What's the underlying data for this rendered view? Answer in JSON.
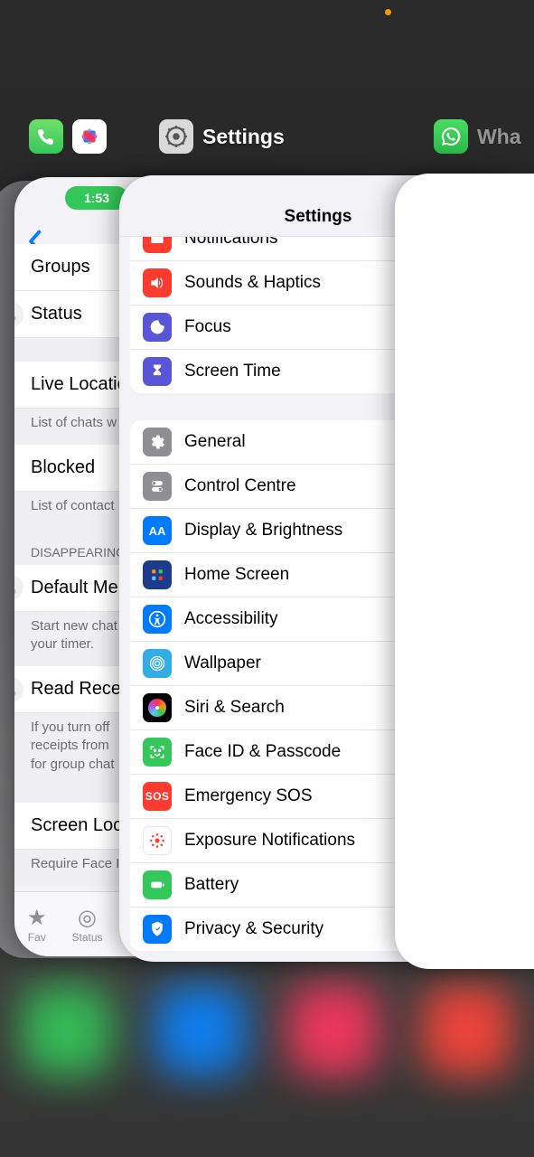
{
  "switcher": {
    "settings_label": "Settings",
    "whatsapp_label": "Wha"
  },
  "whatsapp_card": {
    "status_time": "1:53",
    "rows": {
      "groups": "Groups",
      "status": "Status",
      "live_location": "Live Locatio",
      "live_location_sub": "List of chats w",
      "blocked": "Blocked",
      "blocked_sub": "List of contact",
      "disappearing_header": "DISAPPEARING",
      "default_timer": "Default Me:",
      "default_timer_sub": "Start new chat\nyour timer.",
      "read_receipts": "Read Recei",
      "read_receipts_sub": "If you turn off\nreceipts from\nfor group chat",
      "screen_lock": "Screen Loc",
      "screen_lock_sub": "Require Face I"
    },
    "tabs": {
      "favourites": "Fav",
      "status": "Status"
    }
  },
  "settings_card": {
    "title": "Settings",
    "section1": [
      {
        "key": "notifications",
        "label": "Notifications"
      },
      {
        "key": "sounds",
        "label": "Sounds & Haptics"
      },
      {
        "key": "focus",
        "label": "Focus"
      },
      {
        "key": "screentime",
        "label": "Screen Time"
      }
    ],
    "section2": [
      {
        "key": "general",
        "label": "General"
      },
      {
        "key": "control",
        "label": "Control Centre"
      },
      {
        "key": "display",
        "label": "Display & Brightness"
      },
      {
        "key": "homescreen",
        "label": "Home Screen"
      },
      {
        "key": "accessibility",
        "label": "Accessibility"
      },
      {
        "key": "wallpaper",
        "label": "Wallpaper"
      },
      {
        "key": "siri",
        "label": "Siri & Search"
      },
      {
        "key": "faceid",
        "label": "Face ID & Passcode"
      },
      {
        "key": "sos",
        "label": "Emergency SOS"
      },
      {
        "key": "exposure",
        "label": "Exposure Notifications"
      },
      {
        "key": "battery",
        "label": "Battery"
      },
      {
        "key": "privacy",
        "label": "Privacy & Security"
      }
    ]
  },
  "dock_colors": [
    "#34c759",
    "#0a84ff",
    "#ff375f",
    "#ff453a"
  ]
}
